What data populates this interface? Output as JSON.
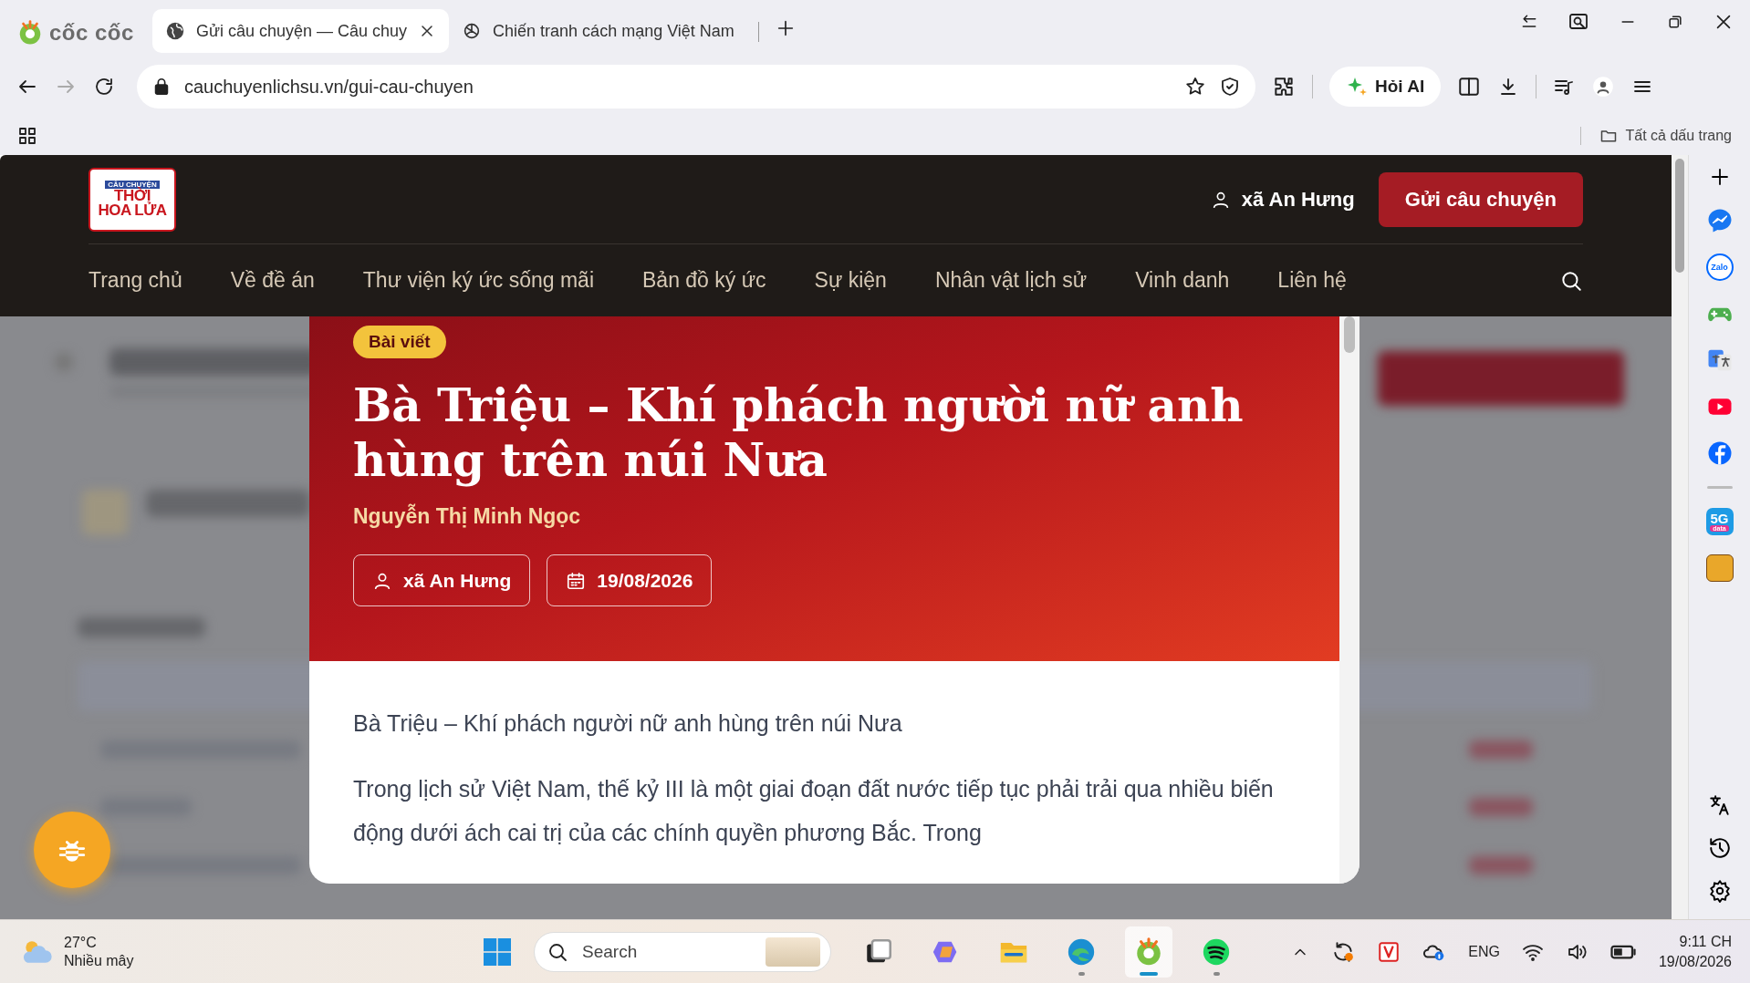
{
  "browser": {
    "brand": "cốc cốc",
    "tabs": [
      {
        "title": "Gửi câu chuyện — Câu chuy",
        "selected": true
      },
      {
        "title": "Chiến tranh cách mạng Việt Nam",
        "selected": false
      }
    ],
    "forward": {
      "disabled": true
    },
    "url": "cauchuyenlichsu.vn/gui-cau-chuyen",
    "ai_button": "Hỏi AI",
    "bookmarks_label": "Tất cả dấu trang"
  },
  "site": {
    "logo": {
      "small": "CÂU CHUYỆN",
      "line1": "THỜI",
      "line2": "HOA LỬA"
    },
    "user": "xã An Hưng",
    "submit_button": "Gửi câu chuyện",
    "nav": [
      "Trang chủ",
      "Về đề án",
      "Thư viện ký ức sống mãi",
      "Bản đồ ký ức",
      "Sự kiện",
      "Nhân vật lịch sử",
      "Vinh danh",
      "Liên hệ"
    ]
  },
  "modal": {
    "badge": "Bài viết",
    "title": "Bà Triệu – Khí phách người nữ anh hùng trên núi Nưa",
    "author": "Nguyễn Thị Minh Ngọc",
    "location": "xã An Hưng",
    "date": "19/08/2026",
    "paragraphs": [
      "Bà Triệu – Khí phách người nữ anh hùng trên núi Nưa",
      "Trong lịch sử Việt Nam, thế kỷ III là một giai đoạn đất nước tiếp tục phải trải qua nhiều biến động dưới ách cai trị của các chính quyền phương Bắc. Trong"
    ]
  },
  "sidebar": {
    "apps": [
      {
        "kind": "add"
      },
      {
        "kind": "messenger"
      },
      {
        "kind": "zalo",
        "label": "Zalo"
      },
      {
        "kind": "game"
      },
      {
        "kind": "translate"
      },
      {
        "kind": "youtube"
      },
      {
        "kind": "facebook"
      },
      {
        "kind": "divider"
      },
      {
        "kind": "data5g",
        "label": "5G",
        "sublabel": "data"
      },
      {
        "kind": "avatar"
      }
    ]
  },
  "taskbar": {
    "temperature": "27°C",
    "weather": "Nhiều mây",
    "search_placeholder": "Search",
    "apps": [
      {
        "kind": "task-view",
        "running": false,
        "selected": false
      },
      {
        "kind": "copilot",
        "running": false,
        "selected": false
      },
      {
        "kind": "files",
        "running": false,
        "selected": false
      },
      {
        "kind": "edge",
        "running": true,
        "selected": false
      },
      {
        "kind": "coccoc",
        "running": true,
        "selected": true
      },
      {
        "kind": "spotify",
        "running": true,
        "selected": false
      }
    ],
    "language": "ENG",
    "time": "9:11 CH",
    "date": "19/08/2026"
  }
}
